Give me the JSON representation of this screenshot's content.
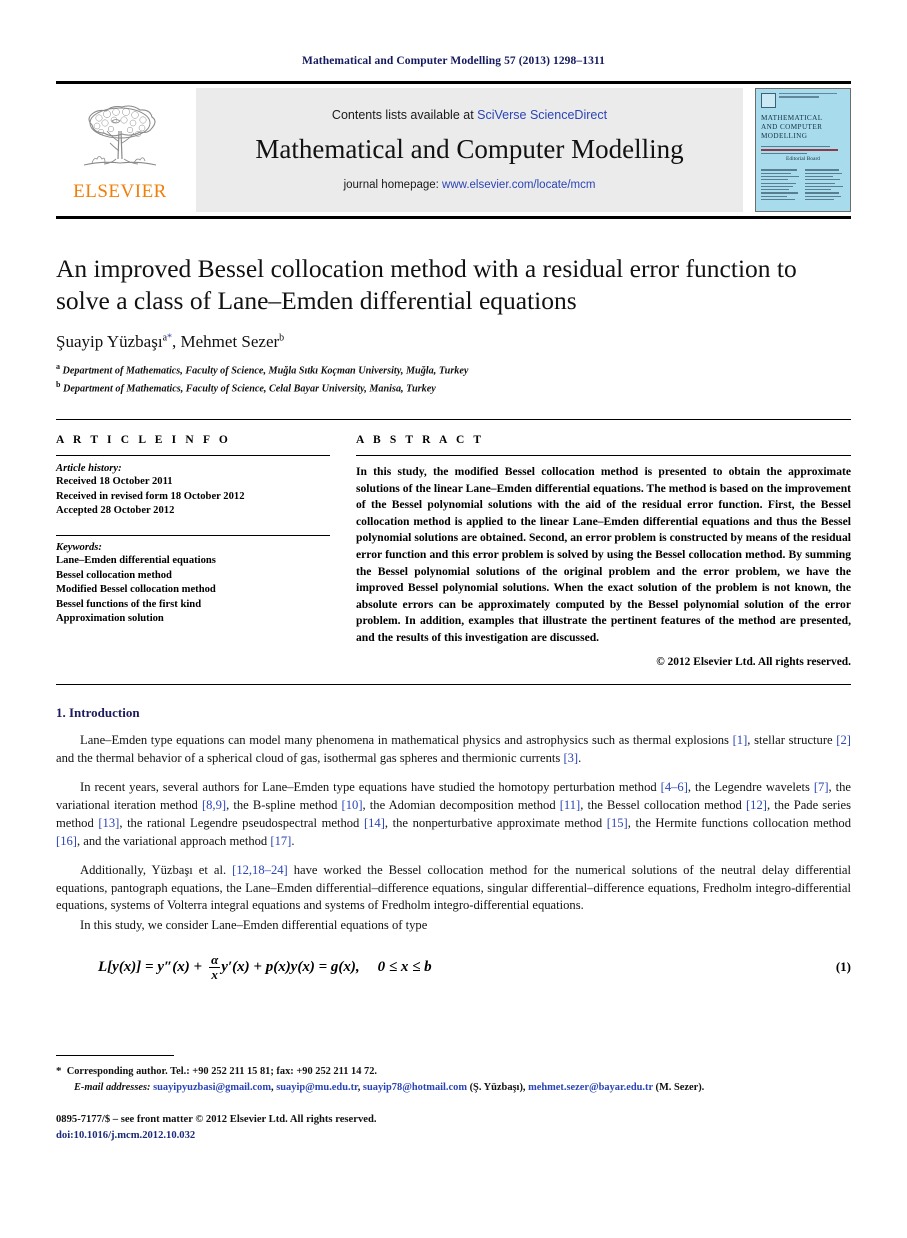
{
  "running_head": "Mathematical and Computer Modelling 57 (2013) 1298–1311",
  "masthead": {
    "publisher_name": "ELSEVIER",
    "contents_prefix": "Contents lists available at ",
    "contents_link": "SciVerse ScienceDirect",
    "journal_title": "Mathematical and Computer Modelling",
    "homepage_prefix": "journal homepage: ",
    "homepage_link": "www.elsevier.com/locate/mcm",
    "cover": {
      "title_line1": "MATHEMATICAL",
      "title_line2": "AND COMPUTER",
      "title_line3": "MODELLING",
      "column_label": "Editorial Board"
    }
  },
  "article": {
    "title": "An improved Bessel collocation method with a residual error function to solve a class of Lane–Emden differential equations",
    "authors": [
      {
        "name": "Şuayip Yüzbaşı",
        "sup": "a",
        "star": "*"
      },
      {
        "name": "Mehmet Sezer",
        "sup": "b"
      }
    ],
    "affiliations": [
      {
        "marker": "a",
        "text": "Department of Mathematics, Faculty of Science, Muğla Sıtkı Koçman University, Muğla, Turkey"
      },
      {
        "marker": "b",
        "text": "Department of Mathematics, Faculty of Science, Celal Bayar University, Manisa, Turkey"
      }
    ]
  },
  "info": {
    "heading": "A R T I C L E   I N F O",
    "history_label": "Article history:",
    "history": [
      "Received 18 October 2011",
      "Received in revised form 18 October 2012",
      "Accepted 28 October 2012"
    ],
    "keywords_label": "Keywords:",
    "keywords": [
      "Lane–Emden differential equations",
      "Bessel collocation method",
      "Modified Bessel collocation method",
      "Bessel functions of the first kind",
      "Approximation solution"
    ]
  },
  "abstract": {
    "heading": "A B S T R A C T",
    "text": "In this study, the modified Bessel collocation method is presented to obtain the approximate solutions of the linear Lane–Emden differential equations. The method is based on the improvement of the Bessel polynomial solutions with the aid of the residual error function. First, the Bessel collocation method is applied to the linear Lane–Emden differential equations and thus the Bessel polynomial solutions are obtained. Second, an error problem is constructed by means of the residual error function and this error problem is solved by using the Bessel collocation method. By summing the Bessel polynomial solutions of the original problem and the error problem, we have the improved Bessel polynomial solutions. When the exact solution of the problem is not known, the absolute errors can be approximately computed by the Bessel polynomial solution of the error problem. In addition, examples that illustrate the pertinent features of the method are presented, and the results of this investigation are discussed.",
    "copyright": "© 2012 Elsevier Ltd. All rights reserved."
  },
  "body": {
    "section_title": "1. Introduction",
    "paragraphs": [
      {
        "segments": [
          {
            "t": "Lane–Emden type equations can model many phenomena in mathematical physics and astrophysics such as thermal explosions "
          },
          {
            "t": "[1]",
            "cite": true
          },
          {
            "t": ", stellar structure "
          },
          {
            "t": "[2]",
            "cite": true
          },
          {
            "t": " and the thermal behavior of a spherical cloud of gas, isothermal gas spheres and thermionic currents "
          },
          {
            "t": "[3]",
            "cite": true
          },
          {
            "t": "."
          }
        ]
      },
      {
        "segments": [
          {
            "t": "In recent years, several authors for Lane–Emden type equations have studied the homotopy perturbation method "
          },
          {
            "t": "[4–6]",
            "cite": true
          },
          {
            "t": ", the Legendre wavelets "
          },
          {
            "t": "[7]",
            "cite": true
          },
          {
            "t": ", the variational iteration method "
          },
          {
            "t": "[8,9]",
            "cite": true
          },
          {
            "t": ", the B-spline method "
          },
          {
            "t": "[10]",
            "cite": true
          },
          {
            "t": ", the Adomian decomposition method "
          },
          {
            "t": "[11]",
            "cite": true
          },
          {
            "t": ", the Bessel collocation method "
          },
          {
            "t": "[12]",
            "cite": true
          },
          {
            "t": ", the Pade series method "
          },
          {
            "t": "[13]",
            "cite": true
          },
          {
            "t": ", the rational Legendre pseudospectral method "
          },
          {
            "t": "[14]",
            "cite": true
          },
          {
            "t": ", the nonperturbative approximate method "
          },
          {
            "t": "[15]",
            "cite": true
          },
          {
            "t": ", the Hermite functions collocation method "
          },
          {
            "t": "[16]",
            "cite": true
          },
          {
            "t": ", and the variational approach method "
          },
          {
            "t": "[17]",
            "cite": true
          },
          {
            "t": "."
          }
        ]
      },
      {
        "segments": [
          {
            "t": "Additionally, Yüzbaşı et al. "
          },
          {
            "t": "[12,18–24]",
            "cite": true
          },
          {
            "t": " have worked the Bessel collocation method for the numerical solutions of the neutral delay differential equations, pantograph equations, the Lane–Emden differential–difference equations, singular differential–difference equations, Fredholm integro-differential equations, systems of Volterra integral equations and systems of Fredholm integro-differential equations."
          }
        ]
      },
      {
        "segments": [
          {
            "t": "In this study, we consider Lane–Emden differential equations of type"
          }
        ]
      }
    ],
    "equation": {
      "lhs": "L[y(x)] = y″(x) +",
      "frac_num": "α",
      "frac_den": "x",
      "mid": "y′(x) + p(x)y(x) = g(x),",
      "range": "0 ≤ x ≤ b",
      "number": "(1)"
    }
  },
  "footer": {
    "corresponding": "Corresponding author. Tel.: +90 252 211 15 81; fax: +90 252 211 14 72.",
    "email_label": "E-mail addresses:",
    "emails": [
      {
        "address": "suayipyuzbasi@gmail.com",
        "sep": ", "
      },
      {
        "address": "suayip@mu.edu.tr",
        "sep": ", "
      },
      {
        "address": "suayip78@hotmail.com",
        "sep": " "
      }
    ],
    "author1_paren": "(Ş. Yüzbaşı),",
    "email_last": "mehmet.sezer@bayar.edu.tr",
    "author2_paren": "(M. Sezer).",
    "issn_line": "0895-7177/$ – see front matter © 2012 Elsevier Ltd. All rights reserved.",
    "doi_line": "doi:10.1016/j.mcm.2012.10.032"
  }
}
